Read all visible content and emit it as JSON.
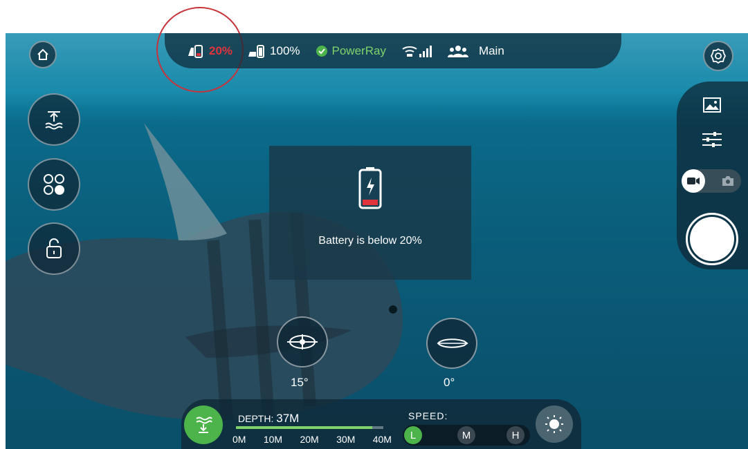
{
  "status": {
    "phone_battery": "20%",
    "drone_battery": "100%",
    "connection": "PowerRay",
    "mode": "Main"
  },
  "toast": {
    "message": "Battery is below 20%"
  },
  "angles": {
    "pitch": "15°",
    "roll": "0°"
  },
  "depth": {
    "label": "DEPTH:",
    "value": "37M",
    "fraction": 0.925,
    "ticks": [
      "0M",
      "10M",
      "20M",
      "30M",
      "40M"
    ]
  },
  "speed": {
    "label": "SPEED:",
    "options": [
      "L",
      "M",
      "H"
    ],
    "selected": "L"
  },
  "colors": {
    "accent_green": "#4cb44a",
    "warning_red": "#e0333b",
    "connection_green": "#7fd36b"
  },
  "icons": [
    "home-icon",
    "phone-battery-icon",
    "drone-battery-icon",
    "check-icon",
    "wifi-signal-icon",
    "users-icon",
    "settings-icon",
    "surface-icon",
    "modes-icon",
    "unlock-icon",
    "gallery-icon",
    "adjust-icon",
    "video-icon",
    "camera-icon",
    "shutter-icon",
    "pitch-icon",
    "roll-icon",
    "anchor-icon",
    "light-icon"
  ]
}
